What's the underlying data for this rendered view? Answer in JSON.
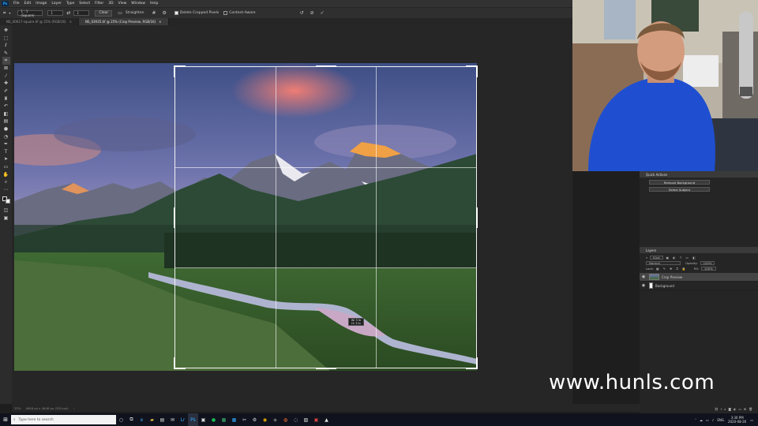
{
  "menubar": {
    "app_icon": "Ps",
    "items": [
      "File",
      "Edit",
      "Image",
      "Layer",
      "Type",
      "Select",
      "Filter",
      "3D",
      "View",
      "Window",
      "Help"
    ]
  },
  "options_bar": {
    "tool_icon": "crop-icon",
    "ratio_preset": "1 : 1 (Square)",
    "ratio_w": "1",
    "ratio_h": "1",
    "clear_label": "Clear",
    "straighten_label": "Straighten",
    "delete_cropped_label": "Delete Cropped Pixels",
    "content_aware_label": "Content-Aware"
  },
  "tabs": [
    {
      "label": "NS_00617-square.tif @ 25% (RGB/16)",
      "active": false
    },
    {
      "label": "NS_03935.tif @ 25% (Crop Preview, RGB/16)",
      "active": true
    }
  ],
  "toolbar": {
    "tools": [
      "move-icon",
      "marquee-icon",
      "lasso-icon",
      "quick-select-icon",
      "crop-icon",
      "frame-icon",
      "eyedropper-icon",
      "healing-icon",
      "brush-icon",
      "stamp-icon",
      "history-brush-icon",
      "eraser-icon",
      "gradient-icon",
      "blur-icon",
      "dodge-icon",
      "pen-icon",
      "type-icon",
      "path-select-icon",
      "shape-icon",
      "hand-icon",
      "zoom-icon",
      "more-icon"
    ],
    "selected": "crop-icon"
  },
  "crop": {
    "tooltip_w": "W: 3 in",
    "tooltip_h": "H: 3 in"
  },
  "statusbar": {
    "zoom": "25%",
    "info": "4646 px x 4646 px (300 ppi)"
  },
  "panels": {
    "quick_actions": {
      "title": "Quick Actions",
      "buttons": [
        "Remove Background",
        "Select Subject"
      ]
    },
    "layers": {
      "title": "Layers",
      "kind_label": "Kind",
      "blend_mode": "Normal",
      "opacity_label": "Opacity:",
      "opacity_value": "100%",
      "fill_label": "Fill:",
      "fill_value": "100%",
      "lock_label": "Lock:",
      "items": [
        {
          "name": "Crop Preview",
          "selected": true
        },
        {
          "name": "Background",
          "selected": false
        }
      ]
    }
  },
  "watermark": "www.hunls.com",
  "taskbar": {
    "search_placeholder": "Type here to search",
    "language": "ENG",
    "time": "3:36 PM",
    "date": "2020-08-26"
  },
  "colors": {
    "accent": "#31a8ff",
    "panel_bg": "#252525",
    "chrome_bg": "#323232"
  }
}
